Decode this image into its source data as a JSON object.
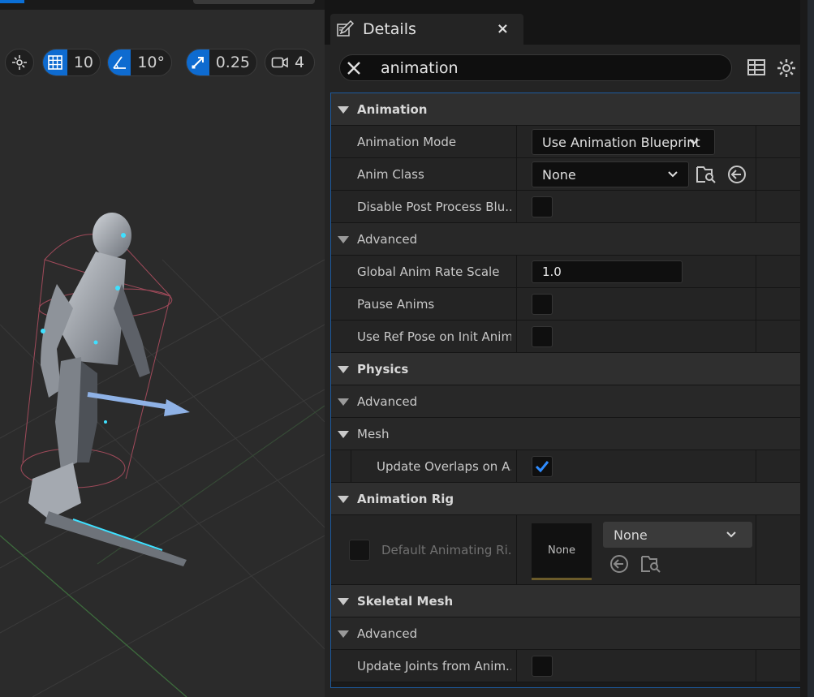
{
  "viewport": {
    "grid_snap_value": "10",
    "rotation_snap_value": "10°",
    "scale_snap_value": "0.25",
    "camera_speed_value": "4",
    "icons": [
      "transform-mode-icon",
      "grid-icon",
      "angle-icon",
      "scale-icon",
      "camera-icon"
    ],
    "accent_color": "#0e6bd0"
  },
  "details": {
    "tab_title": "Details",
    "tab_close": "×",
    "search_value": "animation",
    "sections": {
      "animation": "Animation",
      "physics": "Physics",
      "mesh": "Mesh",
      "animation_rig": "Animation Rig",
      "skeletal_mesh": "Skeletal Mesh"
    },
    "advanced_label": "Advanced",
    "props": {
      "animation_mode": {
        "label": "Animation Mode",
        "value": "Use Animation Blueprint"
      },
      "anim_class": {
        "label": "Anim Class",
        "value": "None"
      },
      "disable_post_process": {
        "label": "Disable Post Process Blu...",
        "checked": false
      },
      "global_anim_rate_scale": {
        "label": "Global Anim Rate Scale",
        "value": "1.0"
      },
      "pause_anims": {
        "label": "Pause Anims",
        "checked": false
      },
      "use_ref_pose": {
        "label": "Use Ref Pose on Init Anim",
        "checked": false
      },
      "update_overlaps": {
        "label": "Update Overlaps on A...",
        "checked": true
      },
      "default_animating_rig": {
        "label": "Default Animating Ri...",
        "thumb": "None",
        "value": "None",
        "checked": false
      },
      "update_joints": {
        "label": "Update Joints from Anim...",
        "checked": false
      }
    },
    "check_color": "#2f8cff",
    "selection_border_color": "#1d5a9e"
  }
}
